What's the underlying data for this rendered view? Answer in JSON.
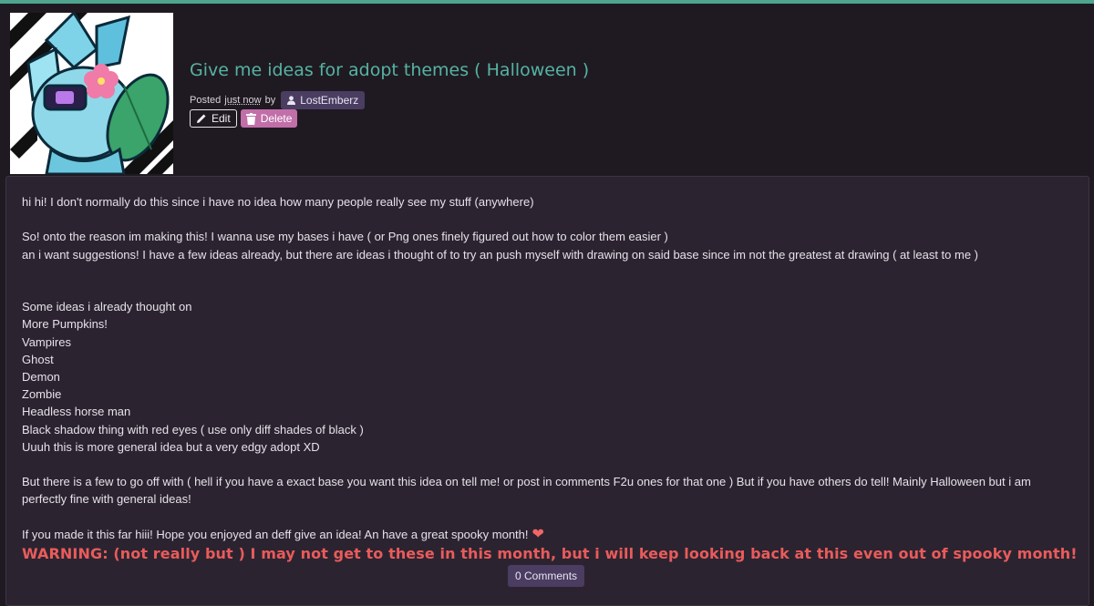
{
  "post": {
    "title": "Give me ideas for adopt themes ( Halloween )",
    "posted_prefix": "Posted",
    "posted_time": "just now",
    "posted_by": "by",
    "author": "LostEmberz",
    "edit_label": "Edit",
    "delete_label": "Delete"
  },
  "body": {
    "line1": "hi hi! I don't normally do this since i have no idea how many people really see my stuff (anywhere)",
    "line2": "So! onto the reason im making this! I wanna use my bases i have ( or Png ones finely figured out how to color them easier )",
    "line3": "an i want suggestions! I have a few ideas already, but there are ideas i thought of to try an push myself with drawing on said base since im not the greatest at drawing ( at least to me )",
    "ideas_heading": "Some ideas i already thought on",
    "ideas": [
      "More Pumpkins!",
      "Vampires",
      "Ghost",
      "Demon",
      "Zombie",
      "Headless horse man",
      "Black shadow thing with red eyes ( use only diff shades of black )",
      "Uuuh this is more general idea but a very edgy adopt XD"
    ],
    "para_offers": "But there is a few to go off with ( hell if you have a exact base you want this idea on tell me! or post in comments F2u ones for that one ) But if you have others do tell! Mainly Halloween but i am perfectly fine with general ideas!",
    "closing": "If you made it this far hiii! Hope you enjoyed an deff give an idea! An have a great spooky month!",
    "warning": "WARNING: (not really but ) I may not get to these in this month, but i will keep looking back at this even out of spooky month!"
  },
  "comments": {
    "label": "0 Comments"
  },
  "colors": {
    "accent": "#56b3a1",
    "topbar": "#4fa58d",
    "badge": "#4a3d61",
    "delete": "#c16ea9",
    "warning": "#ea5b5b",
    "heart": "#f06767"
  },
  "icons": {
    "user": "user-icon",
    "edit": "pencil-icon",
    "delete": "trash-icon",
    "heart": "heart-icon"
  }
}
